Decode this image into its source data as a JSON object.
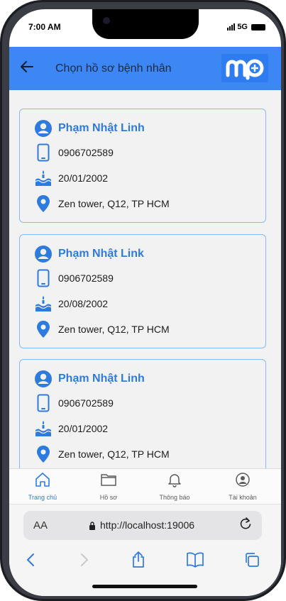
{
  "status_bar": {
    "time": "7:00 AM",
    "network": "5G"
  },
  "header": {
    "title": "Chọn hồ sơ bệnh nhân"
  },
  "patients": [
    {
      "name": "Phạm Nhật Linh",
      "phone": "0906702589",
      "dob": "20/01/2002",
      "address": "Zen tower, Q12, TP HCM"
    },
    {
      "name": "Phạm Nhật Link",
      "phone": "0906702589",
      "dob": "20/08/2002",
      "address": "Zen tower, Q12, TP HCM"
    },
    {
      "name": "Phạm Nhật Linh",
      "phone": "0906702589",
      "dob": "20/01/2002",
      "address": "Zen tower, Q12, TP HCM"
    }
  ],
  "tabbar": {
    "items": [
      {
        "label": "Trang chủ",
        "icon": "home-icon",
        "active": true
      },
      {
        "label": "Hồ sơ",
        "icon": "folder-icon",
        "active": false
      },
      {
        "label": "Thông báo",
        "icon": "bell-icon",
        "active": false
      },
      {
        "label": "Tài khoản",
        "icon": "account-icon",
        "active": false
      }
    ]
  },
  "browser": {
    "aa": "AA",
    "url": "http://localhost:19006"
  },
  "colors": {
    "primary": "#3d87f5",
    "accent": "#2e7be0"
  }
}
